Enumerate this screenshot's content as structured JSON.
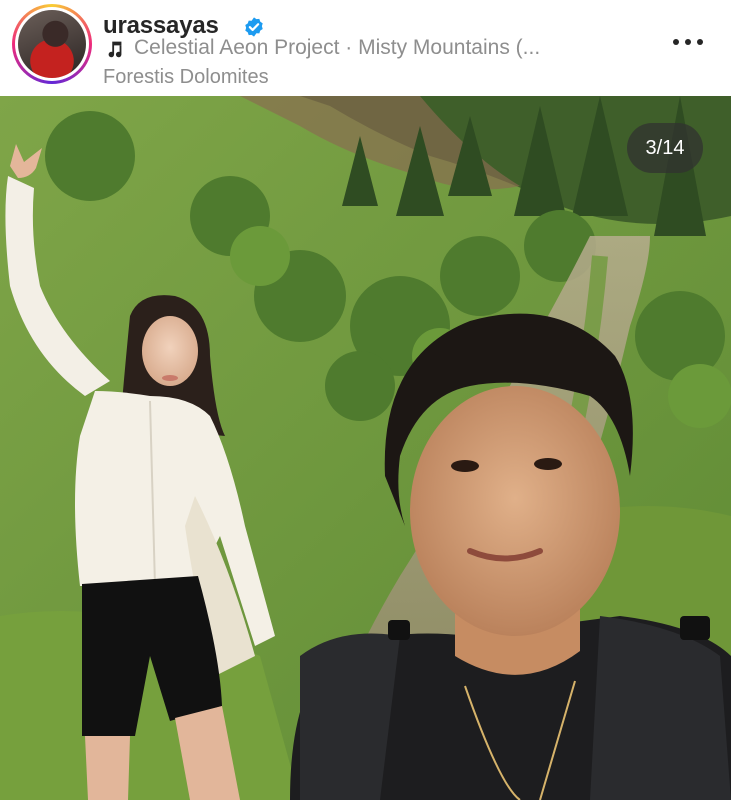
{
  "post": {
    "username": "urassayas",
    "verified": true,
    "audio": "Celestial Aeon Project · Misty Mountains (...",
    "location": "Forestis Dolomites",
    "carousel_counter": "3/14"
  },
  "colors": {
    "ring_start": "#f9ce34",
    "ring_mid": "#ee2a7b",
    "verified_blue": "#1d9bf0",
    "meta_gray": "#8e8e8e"
  },
  "icons": [
    "music-note-icon",
    "verified-badge-icon",
    "more-options-icon"
  ]
}
